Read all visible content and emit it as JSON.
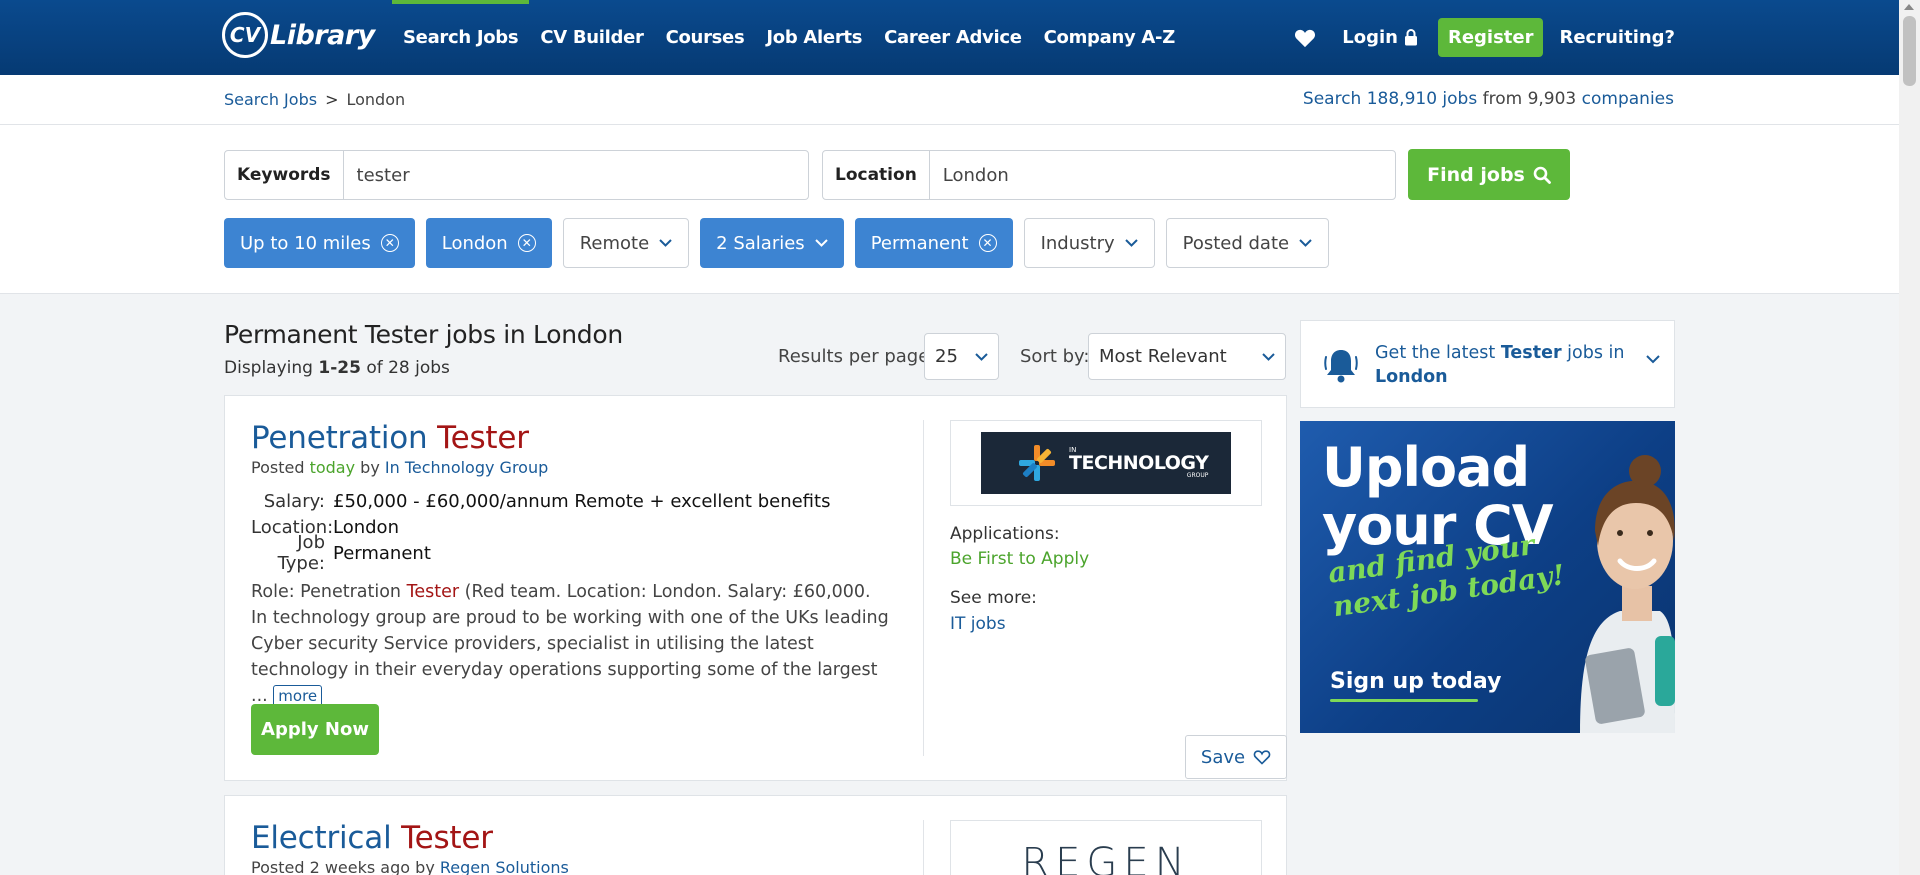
{
  "nav": {
    "logo_cv": "CV",
    "logo_library": "Library",
    "links": [
      "Search Jobs",
      "CV Builder",
      "Courses",
      "Job Alerts",
      "Career Advice",
      "Company A-Z"
    ],
    "login": "Login",
    "register": "Register",
    "recruiting": "Recruiting?"
  },
  "breadcrumb": {
    "root": "Search Jobs",
    "separator": ">",
    "current": "London"
  },
  "stats": {
    "prefix": "Search",
    "jobs_count": "188,910 jobs",
    "middle": "from",
    "companies_count": "9,903",
    "companies_word": "companies"
  },
  "search": {
    "keywords_label": "Keywords",
    "keywords_value": "tester",
    "location_label": "Location",
    "location_value": "London",
    "find_button": "Find jobs"
  },
  "filters": [
    {
      "label": "Up to 10 miles",
      "active": true,
      "control": "remove"
    },
    {
      "label": "London",
      "active": true,
      "control": "remove"
    },
    {
      "label": "Remote",
      "active": false,
      "control": "dropdown"
    },
    {
      "label": "2 Salaries",
      "active": true,
      "control": "dropdown"
    },
    {
      "label": "Permanent",
      "active": true,
      "control": "remove"
    },
    {
      "label": "Industry",
      "active": false,
      "control": "dropdown"
    },
    {
      "label": "Posted date",
      "active": false,
      "control": "dropdown"
    }
  ],
  "results": {
    "title": "Permanent Tester jobs in London",
    "display_prefix": "Displaying",
    "display_range": "1-25",
    "display_suffix": "of 28 jobs",
    "per_page_label": "Results per page:",
    "per_page_value": "25",
    "sort_label": "Sort by:",
    "sort_value": "Most Relevant"
  },
  "jobs": [
    {
      "title_a": "Penetration",
      "title_b": "Tester",
      "posted_prefix": "Posted",
      "posted_when": "today",
      "posted_by": "by",
      "company": "In Technology Group",
      "salary_label": "Salary:",
      "salary": "£50,000 - £60,000/annum Remote + excellent benefits",
      "location_label": "Location:",
      "location": "London",
      "type_label": "Job Type:",
      "type": "Permanent",
      "desc_a": "Role: Penetration",
      "desc_hl": "Tester",
      "desc_b": "(Red team. Location: London. Salary: £60,000. In technology group are proud to be working with one of the UKs leading Cyber security Service providers, specialist in utilising the latest technology in their everyday operations supporting some of the largest ...",
      "more": "more",
      "apply": "Apply Now",
      "logo_small": "IN",
      "logo_big": "TECHNOLOGY",
      "logo_group": "GROUP",
      "applications_label": "Applications:",
      "applications_value": "Be First to Apply",
      "see_more_label": "See more:",
      "see_more_link": "IT jobs",
      "save": "Save"
    },
    {
      "title_a": "Electrical",
      "title_b": "Tester",
      "posted_prefix": "Posted",
      "posted_when": "2 weeks ago",
      "posted_by": "by",
      "company": "Regen Solutions",
      "logo_text": "REGEN"
    }
  ],
  "alert": {
    "prefix": "Get the latest",
    "keyword": "Tester",
    "middle": "jobs in",
    "location": "London"
  },
  "promo": {
    "line1": "Upload",
    "line2": "your CV",
    "sub1": "and find your",
    "sub2": "next job today!",
    "cta": "Sign up today"
  },
  "colors": {
    "nav_blue": "#0a4a8e",
    "accent_green": "#5db83a",
    "chip_blue": "#3d84d2",
    "link_blue": "#1a5b99",
    "highlight_red": "#a31515"
  }
}
